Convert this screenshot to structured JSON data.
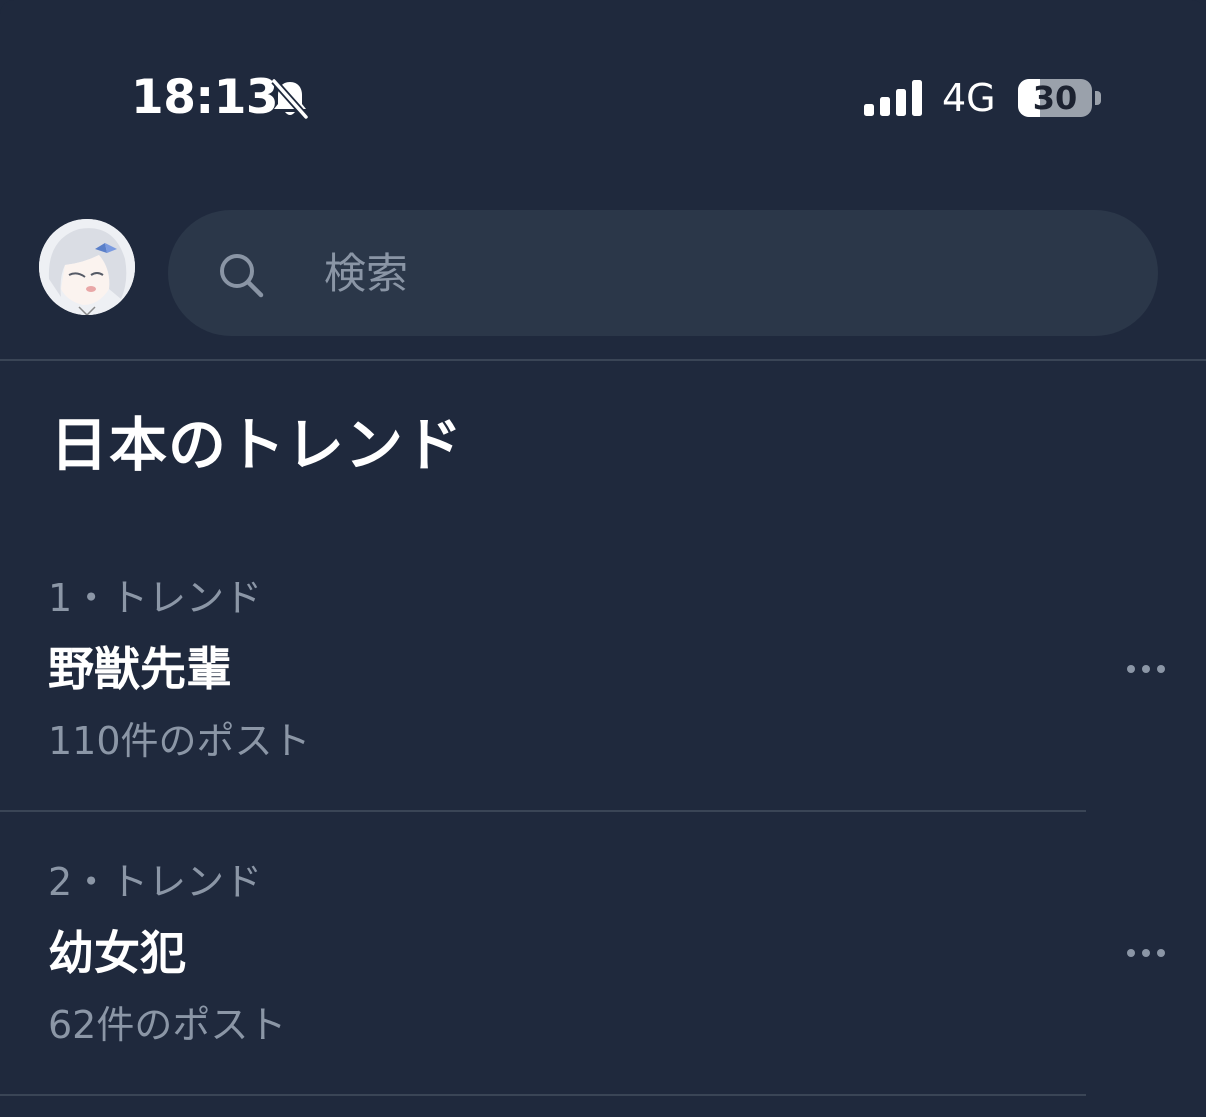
{
  "status_bar": {
    "time": "18:13",
    "network": "4G",
    "battery_level": "30"
  },
  "search": {
    "placeholder": "検索"
  },
  "section": {
    "title": "日本のトレンド"
  },
  "trends": [
    {
      "meta": "1・トレンド",
      "name": "野獣先輩",
      "count": "110件のポスト"
    },
    {
      "meta": "2・トレンド",
      "name": "幼女犯",
      "count": "62件のポスト"
    }
  ],
  "colors": {
    "background": "#1f293d",
    "search_bg": "#2b3749",
    "muted_text": "#8b96a6",
    "divider": "#3a4556"
  }
}
